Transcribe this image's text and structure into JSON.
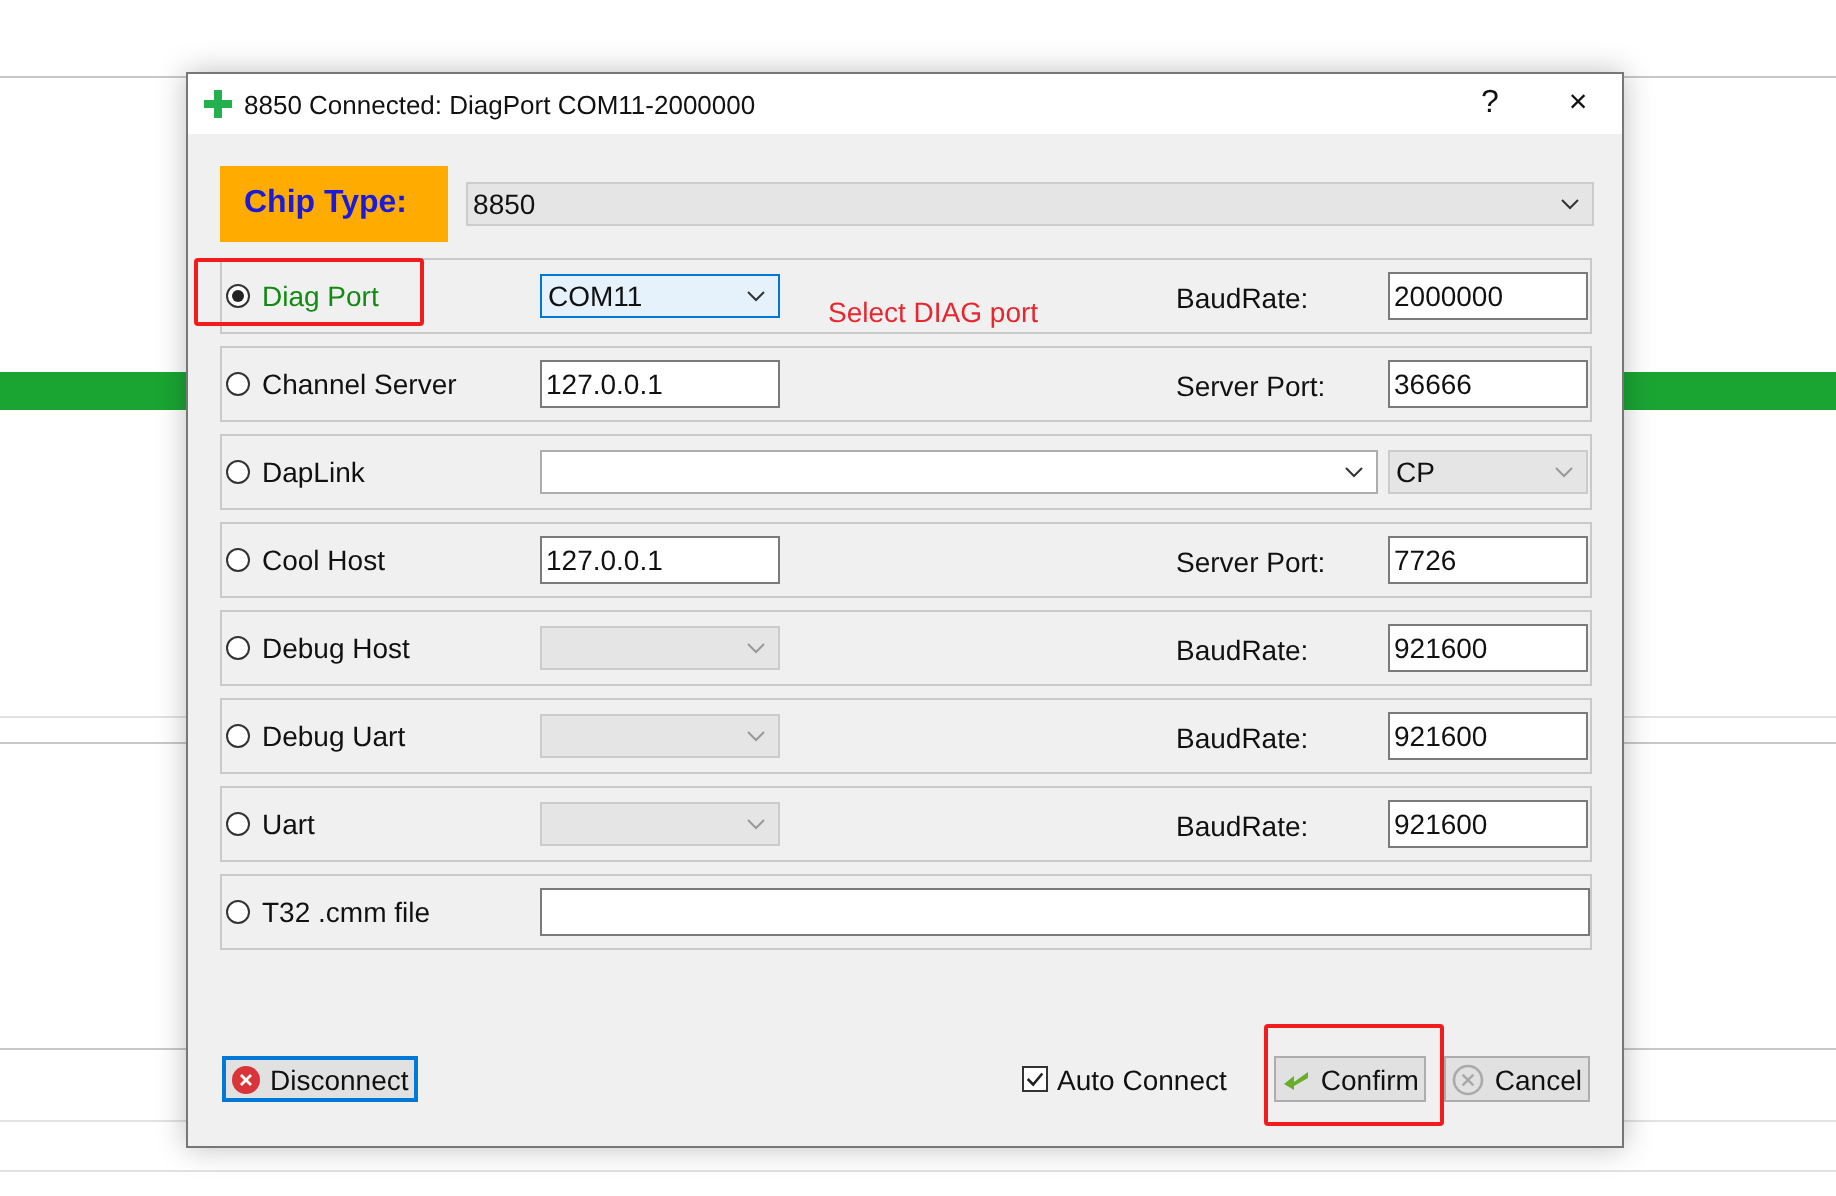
{
  "window": {
    "title": "8850 Connected: DiagPort COM11-2000000",
    "help": "?",
    "close": "×"
  },
  "chip_type": {
    "label": "Chip Type:",
    "value": "8850"
  },
  "rows": [
    {
      "label": "Diag Port",
      "selected": true,
      "highlighted": true,
      "left": {
        "kind": "combo",
        "value": "COM11",
        "disabled": false
      },
      "hint": "Select DIAG port",
      "right_label": "BaudRate:",
      "right": {
        "kind": "input",
        "value": "2000000"
      }
    },
    {
      "label": "Channel Server",
      "selected": false,
      "highlighted": false,
      "left": {
        "kind": "input",
        "value": "127.0.0.1"
      },
      "right_label": "Server Port:",
      "right": {
        "kind": "input",
        "value": "36666"
      }
    },
    {
      "label": "DapLink",
      "selected": false,
      "highlighted": false,
      "left": {
        "kind": "wide-combo",
        "disabled": false
      },
      "right": {
        "kind": "combo",
        "value": "CP",
        "disabled": true
      }
    },
    {
      "label": "Cool Host",
      "selected": false,
      "highlighted": false,
      "left": {
        "kind": "input",
        "value": "127.0.0.1"
      },
      "right_label": "Server Port:",
      "right": {
        "kind": "input",
        "value": "7726"
      }
    },
    {
      "label": "Debug Host",
      "selected": false,
      "highlighted": false,
      "left": {
        "kind": "combo",
        "disabled": true
      },
      "right_label": "BaudRate:",
      "right": {
        "kind": "input",
        "value": "921600"
      }
    },
    {
      "label": "Debug Uart",
      "selected": false,
      "highlighted": false,
      "left": {
        "kind": "combo",
        "disabled": true
      },
      "right_label": "BaudRate:",
      "right": {
        "kind": "input",
        "value": "921600"
      }
    },
    {
      "label": "Uart",
      "selected": false,
      "highlighted": false,
      "left": {
        "kind": "combo",
        "disabled": true
      },
      "right_label": "BaudRate:",
      "right": {
        "kind": "input",
        "value": "921600"
      }
    },
    {
      "label": "T32 .cmm file",
      "selected": false,
      "highlighted": false,
      "left": {
        "kind": "wide-input"
      }
    }
  ],
  "footer": {
    "disconnect": "Disconnect",
    "auto_connect": {
      "label": "Auto Connect",
      "checked": true
    },
    "confirm": {
      "label": "Confirm",
      "highlighted": true
    },
    "cancel": "Cancel"
  }
}
